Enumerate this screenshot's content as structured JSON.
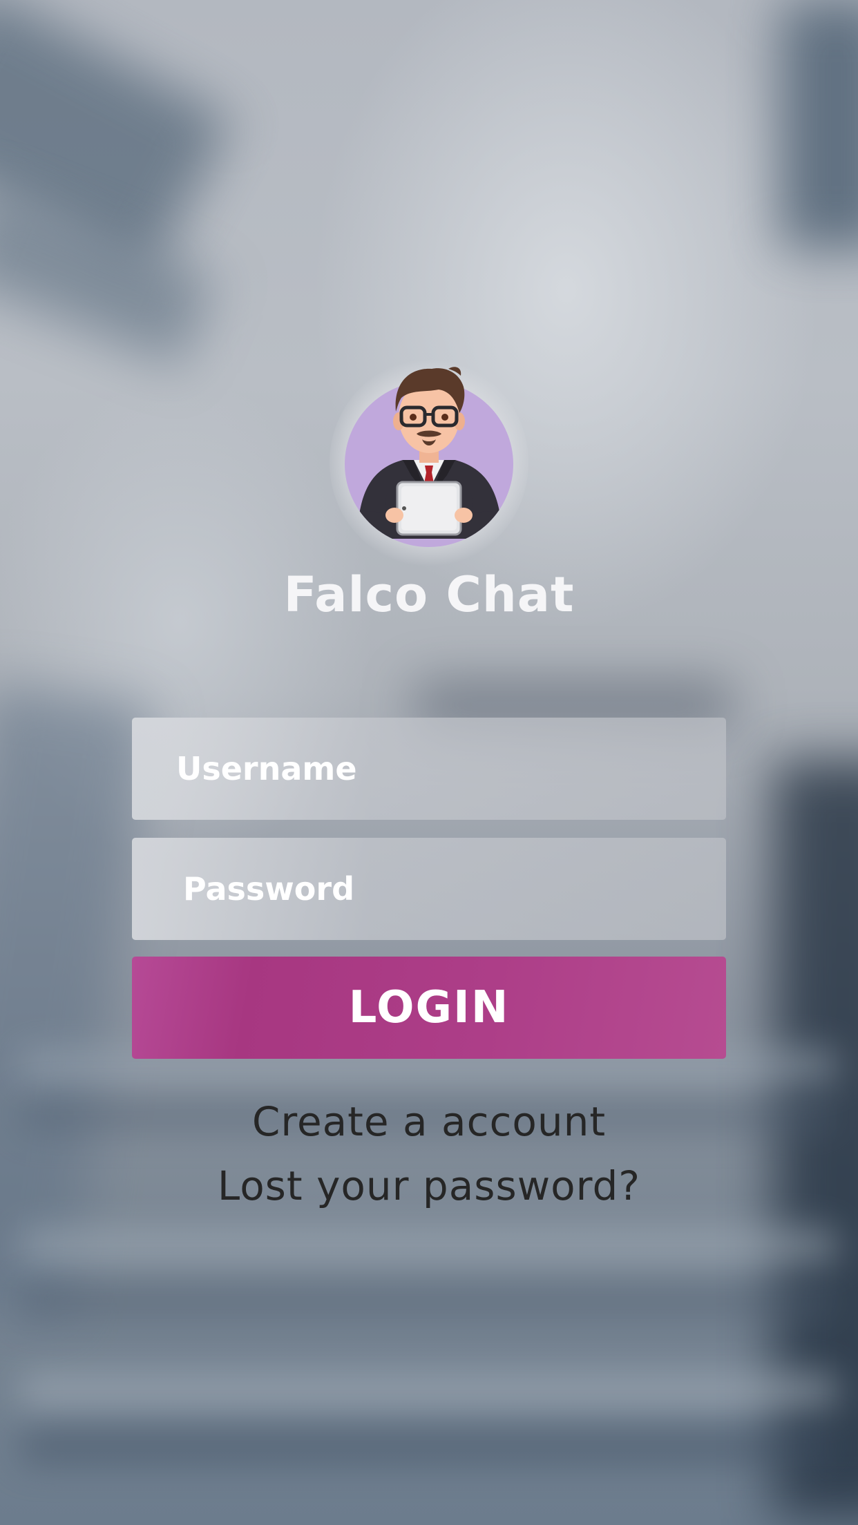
{
  "app": {
    "title": "Falco Chat"
  },
  "avatar": {
    "icon": "businessman-with-tablet-avatar"
  },
  "login_form": {
    "username_placeholder": "Username",
    "username_value": "",
    "password_placeholder": "Password",
    "password_value": "",
    "login_label": "LOGIN"
  },
  "links": {
    "create_account": "Create a account",
    "lost_password": "Lost your password?"
  },
  "colors": {
    "accent": "#ad3e88",
    "title_text": "#f5f5f7",
    "link_text": "#262626",
    "avatar_circle": "#c0a8dc"
  }
}
